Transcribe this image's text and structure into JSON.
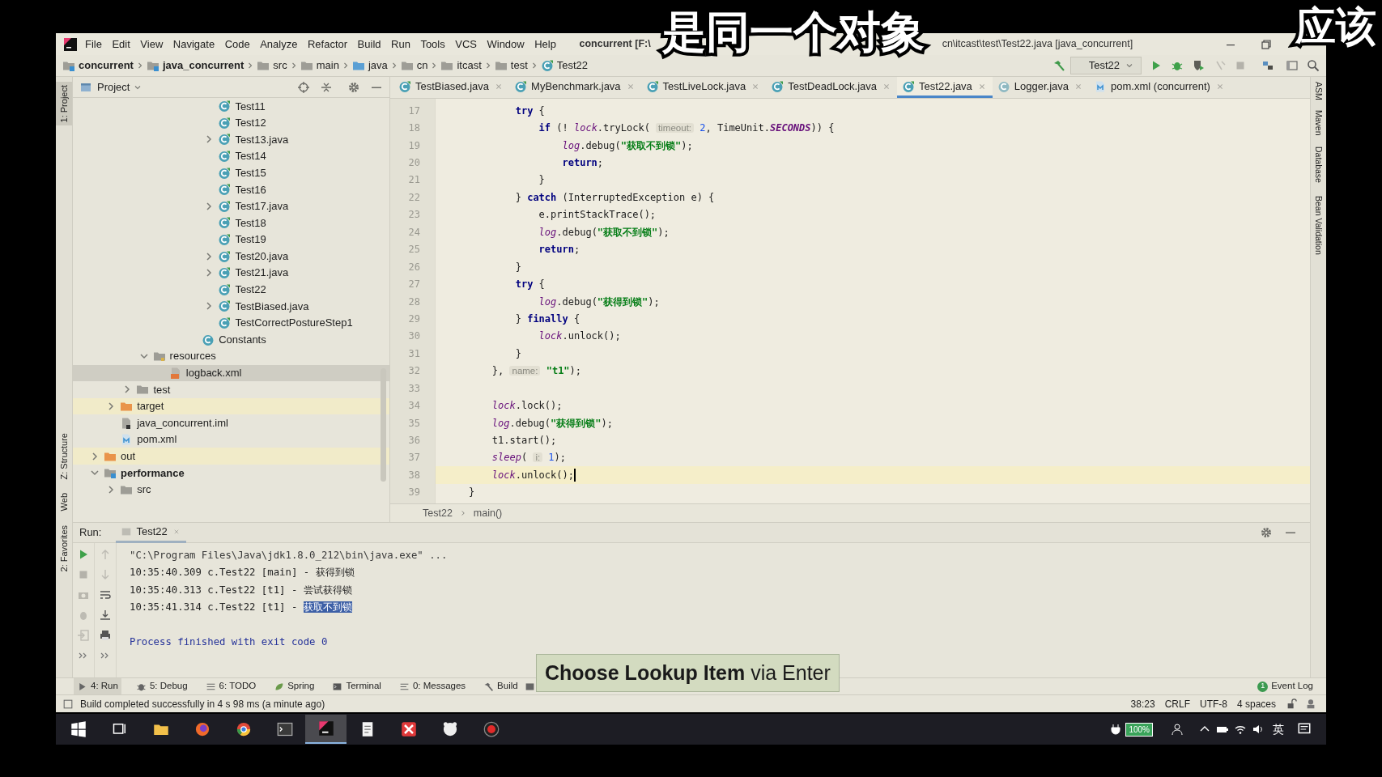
{
  "window": {
    "title_parts": [
      "concurrent [F:\\",
      "cn\\itcast\\test\\Test22.java [java_concurrent]"
    ]
  },
  "subtitles": [
    "是同一个对象",
    "应该"
  ],
  "menu": [
    "File",
    "Edit",
    "View",
    "Navigate",
    "Code",
    "Analyze",
    "Refactor",
    "Build",
    "Run",
    "Tools",
    "VCS",
    "Window",
    "Help"
  ],
  "navbar": {
    "breadcrumbs": [
      {
        "label": "concurrent",
        "kind": "module"
      },
      {
        "label": "java_concurrent",
        "kind": "module"
      },
      {
        "label": "src",
        "kind": "folder"
      },
      {
        "label": "main",
        "kind": "folder"
      },
      {
        "label": "java",
        "kind": "source"
      },
      {
        "label": "cn",
        "kind": "package"
      },
      {
        "label": "itcast",
        "kind": "package"
      },
      {
        "label": "test",
        "kind": "package"
      },
      {
        "label": "Test22",
        "kind": "class"
      }
    ],
    "run_config": "Test22"
  },
  "left_stripe": [
    "1: Project",
    "Z: Structure",
    "Web",
    "2: Favorites"
  ],
  "right_stripe": [
    "ASM",
    "Maven",
    "Database",
    "Bean Validation"
  ],
  "project": {
    "title": "Project",
    "tree": [
      {
        "children": [
          {
            "children": [
              {
                "children": [
                  {
                    "children": [
                      {
                        "children": [
                          {
                            "children": [
                              {
                                "children": [
                                  {
                                    "label": "Test11",
                                    "kind": "class",
                                    "selected": false
                                  },
                                  {
                                    "label": "Test12",
                                    "kind": "class",
                                    "selected": false
                                  },
                                  {
                                    "label": "Test13.java",
                                    "kind": "class",
                                    "selected": false,
                                    "expanded": false
                                  },
                                  {
                                    "label": "Test14",
                                    "kind": "class",
                                    "selected": false
                                  },
                                  {
                                    "label": "Test15",
                                    "kind": "class",
                                    "selected": false
                                  },
                                  {
                                    "label": "Test16",
                                    "kind": "class",
                                    "selected": false
                                  },
                                  {
                                    "label": "Test17.java",
                                    "kind": "class",
                                    "selected": false,
                                    "expanded": false
                                  },
                                  {
                                    "label": "Test18",
                                    "kind": "class",
                                    "selected": false
                                  },
                                  {
                                    "label": "Test19",
                                    "kind": "class",
                                    "selected": false
                                  },
                                  {
                                    "label": "Test20.java",
                                    "kind": "class",
                                    "selected": false,
                                    "expanded": false
                                  },
                                  {
                                    "label": "Test21.java",
                                    "kind": "class",
                                    "selected": false,
                                    "expanded": false
                                  },
                                  {
                                    "label": "Test22",
                                    "kind": "class",
                                    "selected": false
                                  },
                                  {
                                    "label": "TestBiased.java",
                                    "kind": "class",
                                    "selected": false,
                                    "expanded": false
                                  },
                                  {
                                    "label": "TestCorrectPostureStep1",
                                    "kind": "class",
                                    "selected": false
                                  }
                                ]
                              },
                              {
                                "label": "Constants",
                                "kind": "plain_class",
                                "selected": false
                              }
                            ]
                          }
                        ]
                      }
                    ]
                  },
                  {
                    "label": "resources",
                    "kind": "resources",
                    "selected": false,
                    "expanded": true,
                    "children": [
                      {
                        "label": "logback.xml",
                        "kind": "xml",
                        "selected": true
                      }
                    ]
                  }
                ]
              },
              {
                "label": "test",
                "kind": "folder",
                "selected": false,
                "expanded": false
              }
            ]
          },
          {
            "label": "target",
            "kind": "excluded",
            "selected": false,
            "expanded": false
          },
          {
            "label": "java_concurrent.iml",
            "kind": "iml",
            "selected": false
          },
          {
            "label": "pom.xml",
            "kind": "maven",
            "selected": false
          }
        ]
      },
      {
        "label": "out",
        "kind": "excluded",
        "selected": false,
        "expanded": false
      },
      {
        "label": "performance",
        "kind": "module",
        "selected": false,
        "expanded": true,
        "children": [
          {
            "label": "src",
            "kind": "folder",
            "selected": false,
            "expanded": false
          }
        ]
      }
    ]
  },
  "editor": {
    "tabs": [
      {
        "label": "TestBiased.java",
        "kind": "class",
        "selected": false
      },
      {
        "label": "MyBenchmark.java",
        "kind": "class",
        "selected": false
      },
      {
        "label": "TestLiveLock.java",
        "kind": "class",
        "selected": false
      },
      {
        "label": "TestDeadLock.java",
        "kind": "class",
        "selected": false
      },
      {
        "label": "Test22.java",
        "kind": "class",
        "selected": true
      },
      {
        "label": "Logger.java",
        "kind": "library",
        "selected": false
      },
      {
        "label": "pom.xml (concurrent)",
        "kind": "maven",
        "selected": false
      }
    ],
    "lines": [
      {
        "n": "17",
        "current": false,
        "tokens": [
          {
            "kind": "kw",
            "t": "            try"
          },
          {
            "kind": "p",
            "t": " {"
          }
        ]
      },
      {
        "n": "18",
        "current": false,
        "tokens": [
          {
            "kind": "kw",
            "t": "                if"
          },
          {
            "kind": "p",
            "t": " (! "
          },
          {
            "kind": "field",
            "t": "lock"
          },
          {
            "kind": "p",
            "t": ".tryLock( "
          },
          {
            "kind": "hint",
            "t": "timeout:"
          },
          {
            "kind": "num",
            "t": " 2"
          },
          {
            "kind": "p",
            "t": ", TimeUnit."
          },
          {
            "kind": "const",
            "t": "SECONDS"
          },
          {
            "kind": "p",
            "t": ")) {"
          }
        ]
      },
      {
        "n": "19",
        "current": false,
        "tokens": [
          {
            "kind": "field",
            "t": "                    log"
          },
          {
            "kind": "p",
            "t": ".debug("
          },
          {
            "kind": "str",
            "t": "\"获取不到锁\""
          },
          {
            "kind": "p",
            "t": ");"
          }
        ]
      },
      {
        "n": "20",
        "current": false,
        "tokens": [
          {
            "kind": "kw",
            "t": "                    return"
          },
          {
            "kind": "p",
            "t": ";"
          }
        ]
      },
      {
        "n": "21",
        "current": false,
        "tokens": [
          {
            "kind": "p",
            "t": "                }"
          }
        ]
      },
      {
        "n": "22",
        "current": false,
        "tokens": [
          {
            "kind": "p",
            "t": "            } "
          },
          {
            "kind": "kw",
            "t": "catch"
          },
          {
            "kind": "p",
            "t": " (InterruptedException e) {"
          }
        ]
      },
      {
        "n": "23",
        "current": false,
        "tokens": [
          {
            "kind": "p",
            "t": "                e.printStackTrace();"
          }
        ]
      },
      {
        "n": "24",
        "current": false,
        "tokens": [
          {
            "kind": "field",
            "t": "                log"
          },
          {
            "kind": "p",
            "t": ".debug("
          },
          {
            "kind": "str",
            "t": "\"获取不到锁\""
          },
          {
            "kind": "p",
            "t": ");"
          }
        ]
      },
      {
        "n": "25",
        "current": false,
        "tokens": [
          {
            "kind": "kw",
            "t": "                return"
          },
          {
            "kind": "p",
            "t": ";"
          }
        ]
      },
      {
        "n": "26",
        "current": false,
        "tokens": [
          {
            "kind": "p",
            "t": "            }"
          }
        ]
      },
      {
        "n": "27",
        "current": false,
        "tokens": [
          {
            "kind": "kw",
            "t": "            try"
          },
          {
            "kind": "p",
            "t": " {"
          }
        ]
      },
      {
        "n": "28",
        "current": false,
        "tokens": [
          {
            "kind": "field",
            "t": "                log"
          },
          {
            "kind": "p",
            "t": ".debug("
          },
          {
            "kind": "str",
            "t": "\"获得到锁\""
          },
          {
            "kind": "p",
            "t": ");"
          }
        ]
      },
      {
        "n": "29",
        "current": false,
        "tokens": [
          {
            "kind": "p",
            "t": "            } "
          },
          {
            "kind": "kw",
            "t": "finally"
          },
          {
            "kind": "p",
            "t": " {"
          }
        ]
      },
      {
        "n": "30",
        "current": false,
        "tokens": [
          {
            "kind": "field",
            "t": "                lock"
          },
          {
            "kind": "p",
            "t": ".unlock();"
          }
        ]
      },
      {
        "n": "31",
        "current": false,
        "tokens": [
          {
            "kind": "p",
            "t": "            }"
          }
        ]
      },
      {
        "n": "32",
        "current": false,
        "tokens": [
          {
            "kind": "p",
            "t": "        }, "
          },
          {
            "kind": "hint",
            "t": "name:"
          },
          {
            "kind": "str",
            "t": " \"t1\""
          },
          {
            "kind": "p",
            "t": ");"
          }
        ]
      },
      {
        "n": "33",
        "current": false
      },
      {
        "n": "34",
        "current": false,
        "tokens": [
          {
            "kind": "field",
            "t": "        lock"
          },
          {
            "kind": "p",
            "t": ".lock();"
          }
        ]
      },
      {
        "n": "35",
        "current": false,
        "tokens": [
          {
            "kind": "field",
            "t": "        log"
          },
          {
            "kind": "p",
            "t": ".debug("
          },
          {
            "kind": "str",
            "t": "\"获得到锁\""
          },
          {
            "kind": "p",
            "t": ");"
          }
        ]
      },
      {
        "n": "36",
        "current": false,
        "tokens": [
          {
            "kind": "p",
            "t": "        t1.start();"
          }
        ]
      },
      {
        "n": "37",
        "current": false,
        "tokens": [
          {
            "kind": "field",
            "t": "        sleep"
          },
          {
            "kind": "p",
            "t": "( "
          },
          {
            "kind": "hint",
            "t": "i:"
          },
          {
            "kind": "num",
            "t": " 1"
          },
          {
            "kind": "p",
            "t": ");"
          }
        ]
      },
      {
        "n": "38",
        "current": true,
        "tokens": [
          {
            "kind": "field",
            "t": "        lock"
          },
          {
            "kind": "p",
            "t": ".unlock();"
          }
        ]
      },
      {
        "n": "39",
        "current": false,
        "tokens": [
          {
            "kind": "p",
            "t": "    }"
          }
        ]
      }
    ],
    "breadcrumbs": [
      "Test22",
      "main()"
    ]
  },
  "run": {
    "label": "Run:",
    "tab": "Test22",
    "console": [
      {
        "kind": "command",
        "segments": [
          {
            "text": "\"C:\\Program Files\\Java\\jdk1.8.0_212\\bin\\java.exe\" ...",
            "selected": false
          }
        ]
      },
      {
        "kind": "log",
        "segments": [
          {
            "text": "10:35:40.309 c.Test22 [main] - 获得到锁",
            "selected": false
          }
        ]
      },
      {
        "kind": "log",
        "segments": [
          {
            "text": "10:35:40.313 c.Test22 [t1] - 尝试获得锁",
            "selected": false
          }
        ]
      },
      {
        "kind": "log",
        "segments": [
          {
            "text": "10:35:41.314 c.Test22 [t1] - ",
            "selected": false
          },
          {
            "text": "获取不到锁",
            "selected": true
          }
        ]
      },
      {
        "kind": "exit",
        "segments": [
          {
            "text": "Process finished with exit code 0",
            "selected": false
          }
        ]
      }
    ]
  },
  "tool_buttons": [
    {
      "label": "4: Run",
      "kind": "run"
    },
    {
      "label": "5: Debug",
      "kind": "debug"
    },
    {
      "label": "6: TODO",
      "kind": "todo"
    },
    {
      "label": "Spring",
      "kind": "spring"
    },
    {
      "label": "Terminal",
      "kind": "terminal"
    },
    {
      "label": "0: Messages",
      "kind": "messages"
    },
    {
      "label": "Build",
      "kind": "build"
    }
  ],
  "event_log": {
    "count": "1",
    "label": "Event Log"
  },
  "status": {
    "message": "Build completed successfully in 4 s 98 ms (a minute ago)",
    "items": [
      "38:23",
      "CRLF",
      "UTF-8",
      "4 spaces"
    ]
  },
  "lookup_hint": "**Choose Lookup Item** via Enter",
  "taskbar": {
    "apps": [
      {
        "kind": "start",
        "selected": false
      },
      {
        "kind": "taskview",
        "selected": false
      },
      {
        "kind": "folder",
        "selected": false
      },
      {
        "kind": "fox",
        "selected": false
      },
      {
        "kind": "chrome",
        "selected": false
      },
      {
        "kind": "terminal",
        "selected": false
      },
      {
        "kind": "ide",
        "selected": true
      },
      {
        "kind": "notes",
        "selected": false
      },
      {
        "kind": "xmind",
        "selected": false
      },
      {
        "kind": "round",
        "selected": false
      },
      {
        "kind": "record",
        "selected": false
      }
    ],
    "battery": "100%",
    "ime": "英"
  }
}
